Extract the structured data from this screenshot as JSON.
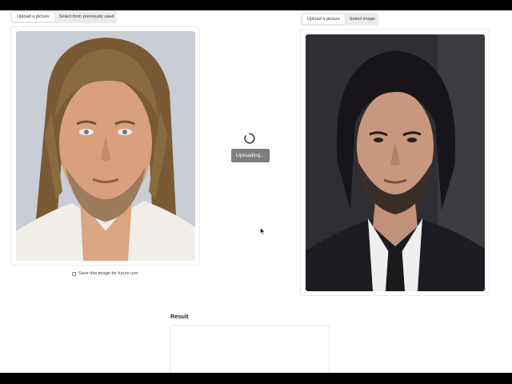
{
  "left_panel": {
    "tabs": [
      "Upload a picture",
      "Select from previously used"
    ],
    "active_tab": 0,
    "save_checkbox_label": "Save this image for future use",
    "save_checked": false
  },
  "right_panel": {
    "tabs": [
      "Upload a picture",
      "Select image"
    ],
    "active_tab": 0
  },
  "status": {
    "uploading_label": "Uploading..."
  },
  "result": {
    "label": "Result"
  },
  "colors": {
    "letterbox": "#000000",
    "badge_bg": "#7d7d7d",
    "tab_bg": "#ececec",
    "card_border": "#e6ebef"
  },
  "icons": [
    "spinner-icon",
    "mouse-cursor-icon"
  ]
}
